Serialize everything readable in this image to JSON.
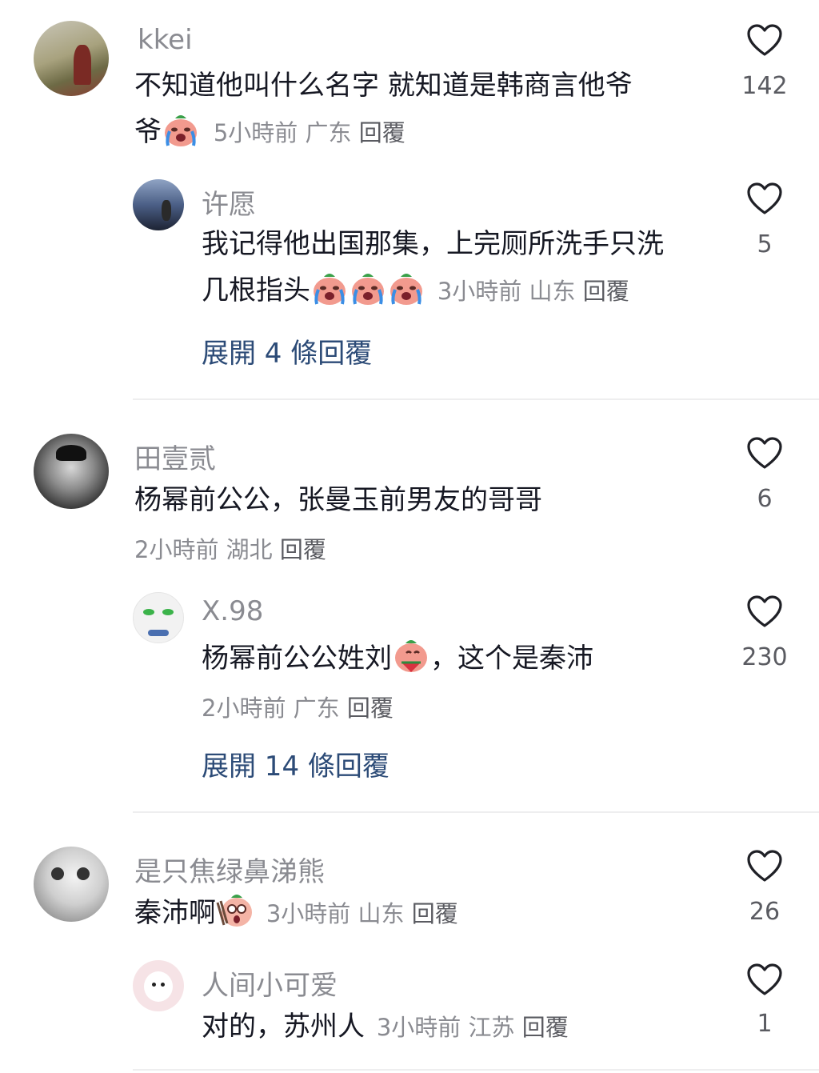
{
  "comments": [
    {
      "author": "kkei",
      "text_line1": "不知道他叫什么名字  就知道是韩商言他爷",
      "text_line2": "爷",
      "time": "5小時前",
      "region": "广东",
      "reply": "回覆",
      "likes": "142",
      "replies": [
        {
          "author": "许愿",
          "text_line1": "我记得他出国那集，上完厕所洗手只洗",
          "text_line2": "几根指头",
          "time": "3小時前",
          "region": "山东",
          "reply": "回覆",
          "likes": "5"
        }
      ],
      "expand_label": "展開 4 條回覆"
    },
    {
      "author": "田壹贰",
      "text_line1": "杨幂前公公，张曼玉前男友的哥哥",
      "time": "2小時前",
      "region": "湖北",
      "reply": "回覆",
      "likes": "6",
      "replies": [
        {
          "author": "X.98",
          "text_before": "杨幂前公公姓刘",
          "text_after": "，这个是秦沛",
          "time": "2小時前",
          "region": "广东",
          "reply": "回覆",
          "likes": "230"
        }
      ],
      "expand_label": "展開 14 條回覆"
    },
    {
      "author": "是只焦绿鼻涕熊",
      "text_line1": "秦沛啊",
      "time": "3小時前",
      "region": "山东",
      "reply": "回覆",
      "likes": "26",
      "replies": [
        {
          "author": "人间小可爱",
          "text_line1": "对的，苏州人",
          "time": "3小時前",
          "region": "江苏",
          "reply": "回覆",
          "likes": "1"
        }
      ]
    }
  ],
  "icons": {
    "like": "heart-outline-icon",
    "emoji_cry": "crying-face-emoji",
    "emoji_watermelon": "watermelon-eating-emoji",
    "emoji_shock": "shocked-face-emoji"
  },
  "colors": {
    "text": "#161823",
    "meta": "#8a8b91",
    "expand": "#2c4b77",
    "divider": "#eeeeef"
  }
}
